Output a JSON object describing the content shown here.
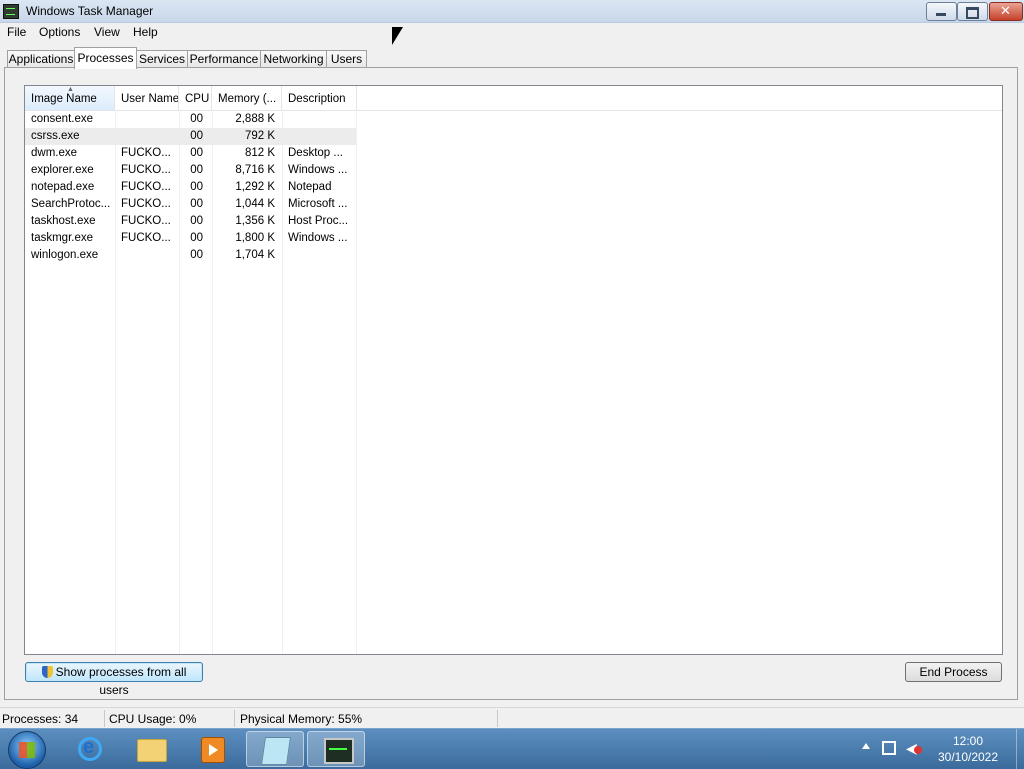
{
  "window": {
    "title": "Windows Task Manager",
    "menu": [
      "File",
      "Options",
      "View",
      "Help"
    ]
  },
  "tabs": [
    "Applications",
    "Processes",
    "Services",
    "Performance",
    "Networking",
    "Users"
  ],
  "active_tab": "Processes",
  "columns": [
    "Image Name",
    "User Name",
    "CPU",
    "Memory (...",
    "Description"
  ],
  "processes": [
    {
      "image": "consent.exe",
      "user": "",
      "cpu": "00",
      "memory": "2,888 K",
      "description": ""
    },
    {
      "image": "csrss.exe",
      "user": "",
      "cpu": "00",
      "memory": "792 K",
      "description": ""
    },
    {
      "image": "dwm.exe",
      "user": "FUCKO...",
      "cpu": "00",
      "memory": "812 K",
      "description": "Desktop ..."
    },
    {
      "image": "explorer.exe",
      "user": "FUCKO...",
      "cpu": "00",
      "memory": "8,716 K",
      "description": "Windows ..."
    },
    {
      "image": "notepad.exe",
      "user": "FUCKO...",
      "cpu": "00",
      "memory": "1,292 K",
      "description": "Notepad"
    },
    {
      "image": "SearchProtoc...",
      "user": "FUCKO...",
      "cpu": "00",
      "memory": "1,044 K",
      "description": "Microsoft ..."
    },
    {
      "image": "taskhost.exe",
      "user": "FUCKO...",
      "cpu": "00",
      "memory": "1,356 K",
      "description": "Host Proc..."
    },
    {
      "image": "taskmgr.exe",
      "user": "FUCKO...",
      "cpu": "00",
      "memory": "1,800 K",
      "description": "Windows ..."
    },
    {
      "image": "winlogon.exe",
      "user": "",
      "cpu": "00",
      "memory": "1,704 K",
      "description": ""
    }
  ],
  "buttons": {
    "show_all": "Show processes from all users",
    "end_process": "End Process"
  },
  "status": {
    "processes": "Processes: 34",
    "cpu": "CPU Usage: 0%",
    "memory": "Physical Memory: 55%"
  },
  "taskbar": {
    "time": "12:00",
    "date": "30/10/2022"
  },
  "colors": {
    "selection": "#ececec",
    "taskbar": "#3a6b9c"
  }
}
